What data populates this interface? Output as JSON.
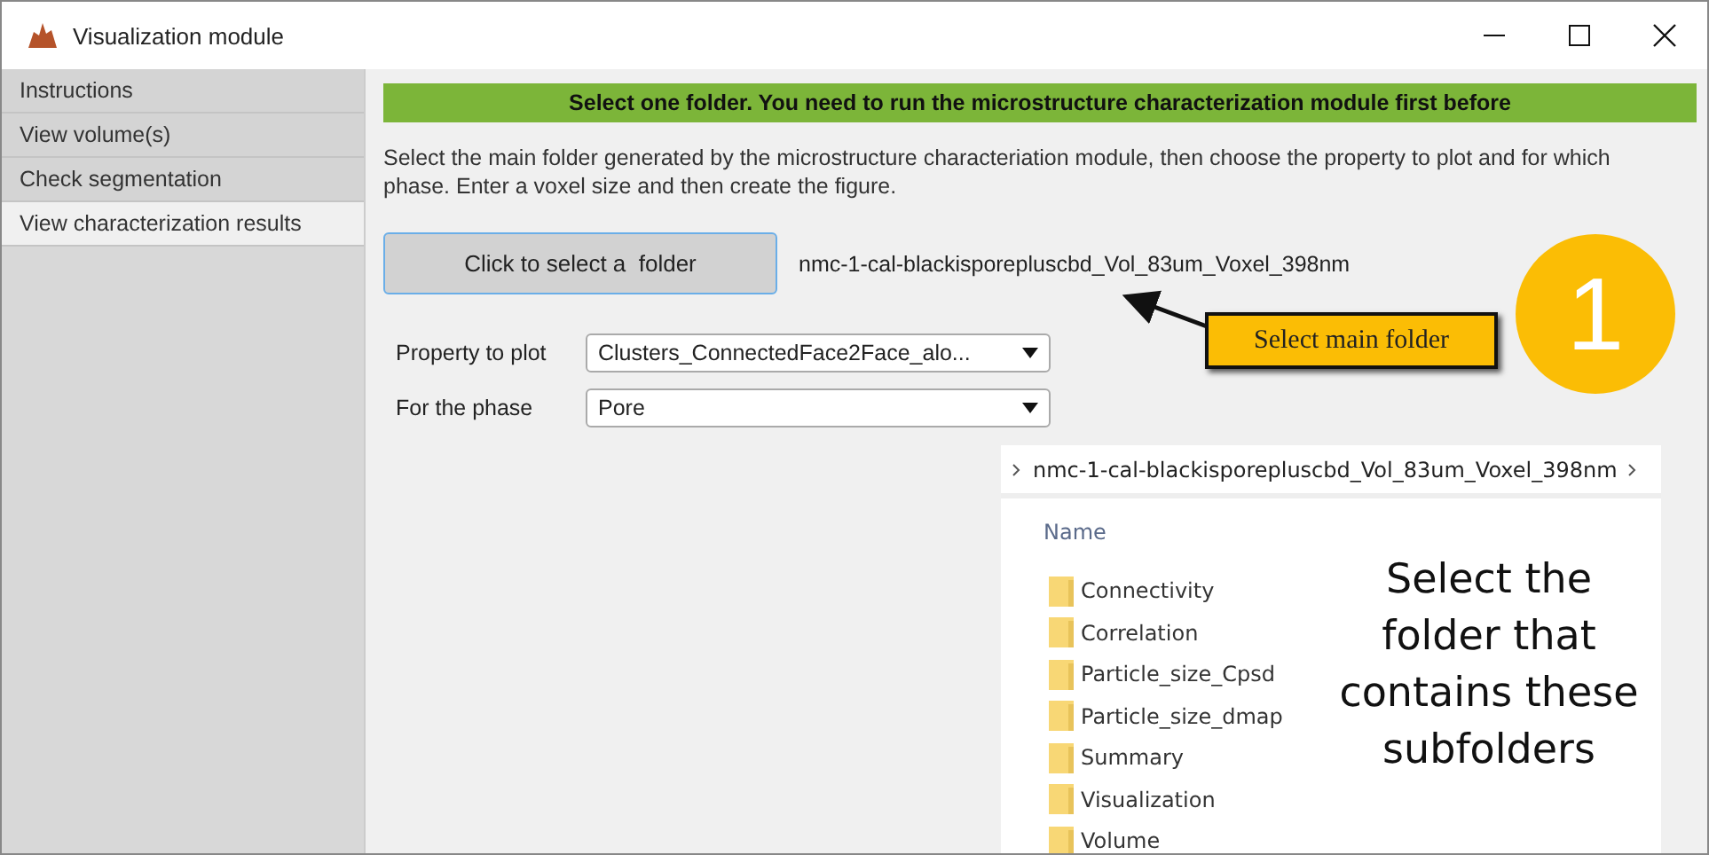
{
  "window": {
    "title": "Visualization module"
  },
  "sidebar": {
    "items": [
      {
        "label": "Instructions",
        "selected": false
      },
      {
        "label": "View volume(s)",
        "selected": false
      },
      {
        "label": "Check segmentation",
        "selected": false
      },
      {
        "label": "View characterization results",
        "selected": true
      }
    ]
  },
  "banner": "Select one folder. You need to run the microstructure characterization module first before",
  "description": "Select the main folder generated by the microstructure characteriation module, then choose the property to plot and for which phase. Enter a voxel size and then create the figure.",
  "select_folder_button": "Click to select a  folder",
  "selected_folder": "nmc-1-cal-blackisporepluscbd_Vol_83um_Voxel_398nm",
  "fields": [
    {
      "label": "Property to plot",
      "value": "Clusters_ConnectedFace2Face_alo..."
    },
    {
      "label": "For the phase",
      "value": "Pore"
    }
  ],
  "annotations": {
    "step_number": "1",
    "callout": "Select main folder"
  },
  "explorer": {
    "path": "nmc-1-cal-blackisporepluscbd_Vol_83um_Voxel_398nm",
    "column": "Name",
    "folders": [
      "Connectivity",
      "Correlation",
      "Particle_size_Cpsd",
      "Particle_size_dmap",
      "Summary",
      "Visualization",
      "Volume"
    ],
    "note_lines": [
      "Select the",
      "folder that",
      "contains these",
      "subfolders"
    ]
  }
}
